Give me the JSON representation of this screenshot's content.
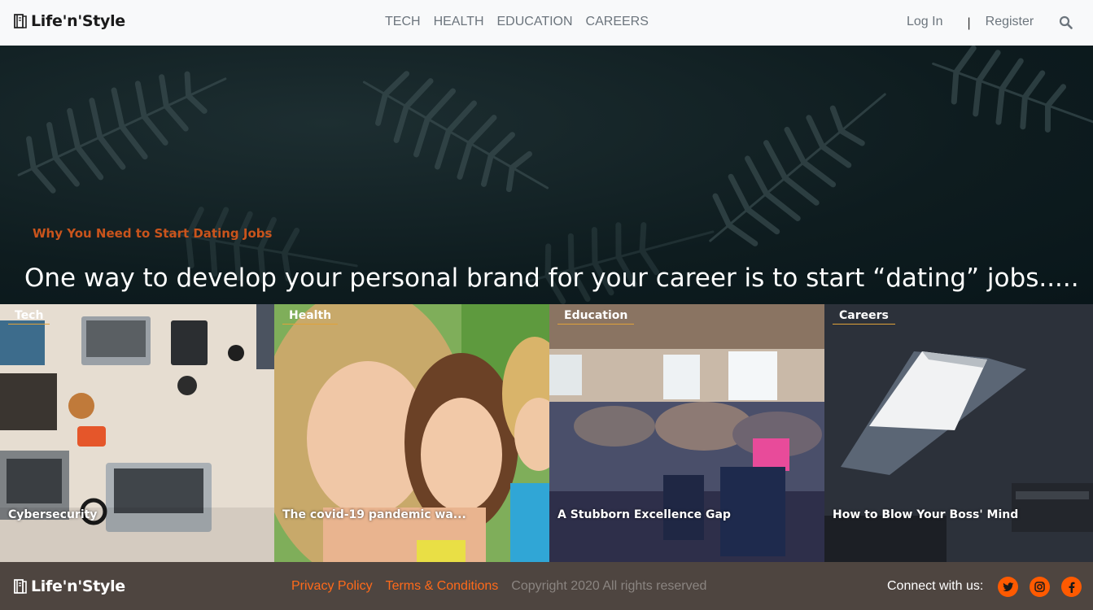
{
  "brand": {
    "name": "Life'n'Style"
  },
  "nav": {
    "items": [
      "TECH",
      "HEALTH",
      "EDUCATION",
      "CAREERS"
    ]
  },
  "auth": {
    "login": "Log In",
    "separator": "|",
    "register": "Register"
  },
  "hero": {
    "kicker": "Why You Need to Start Dating Jobs",
    "title": "One way to develop your personal brand for your career is to start “dating” jobs....."
  },
  "cards": [
    {
      "category": "Tech",
      "title": "Cybersecurity"
    },
    {
      "category": "Health",
      "title": "The covid-19 pandemic wa..."
    },
    {
      "category": "Education",
      "title": "A Stubborn Excellence Gap"
    },
    {
      "category": "Careers",
      "title": "How to Blow Your Boss' Mind"
    }
  ],
  "footer": {
    "privacy": "Privacy Policy",
    "terms": "Terms & Conditions",
    "copyright": "Copyright 2020  All rights reserved",
    "connect": "Connect with us:"
  },
  "colors": {
    "accent": "#ff5a00",
    "kicker": "#c9541c",
    "footer_bg": "#4e4540",
    "header_bg": "#f8f9fa"
  },
  "icons": [
    "book-logo-icon",
    "search-icon",
    "twitter-icon",
    "instagram-icon",
    "facebook-icon"
  ]
}
